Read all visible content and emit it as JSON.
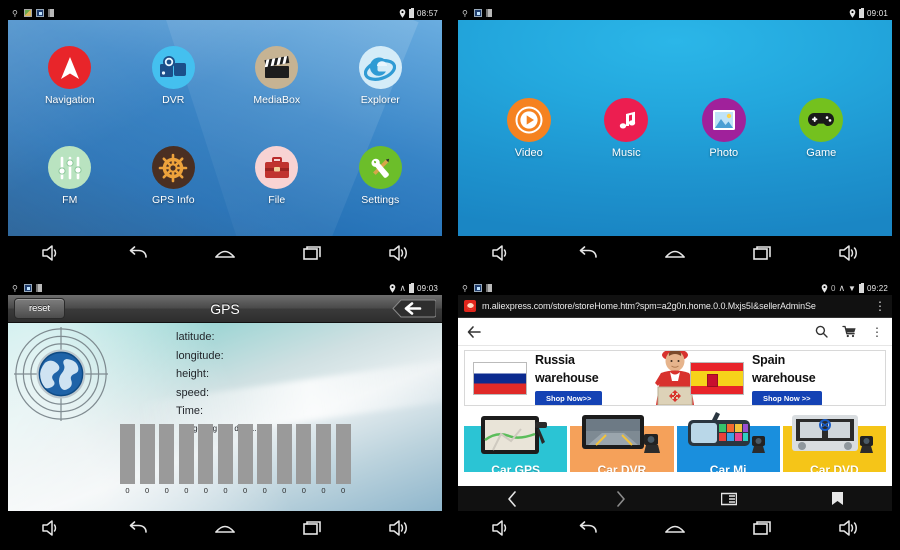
{
  "panels": {
    "launcher_main": {
      "status": {
        "time": "08:57",
        "icons": [
          "gps-icon",
          "gallery-icon",
          "screenshot-icon",
          "sdcard-icon",
          "location-pin-icon",
          "battery-icon"
        ]
      },
      "apps": [
        {
          "label": "Navigation",
          "icon": "navigation-arrow-icon",
          "color": "#e8252a"
        },
        {
          "label": "DVR",
          "icon": "dashcam-icon",
          "color": "#44c0ef"
        },
        {
          "label": "MediaBox",
          "icon": "clapperboard-icon",
          "color": "#c6b393"
        },
        {
          "label": "Explorer",
          "icon": "internet-explorer-icon",
          "color": "#cfeaf8"
        },
        {
          "label": "FM",
          "icon": "equalizer-sliders-icon",
          "color": "#b9e3c0"
        },
        {
          "label": "GPS Info",
          "icon": "ship-wheel-icon",
          "color": "#4a2f22"
        },
        {
          "label": "File",
          "icon": "briefcase-icon",
          "color": "#f8d3d3"
        },
        {
          "label": "Settings",
          "icon": "wrench-screwdriver-icon",
          "color": "#6cbe2a"
        }
      ],
      "navkeys": [
        "volume-down-icon",
        "back-icon",
        "home-icon",
        "recents-icon",
        "volume-up-icon"
      ]
    },
    "launcher_media": {
      "status": {
        "time": "09:01",
        "icons": [
          "gps-icon",
          "screenshot-icon",
          "sdcard-icon",
          "location-pin-icon",
          "battery-icon"
        ]
      },
      "apps": [
        {
          "label": "Video",
          "icon": "play-circle-icon",
          "color": "#f58220"
        },
        {
          "label": "Music",
          "icon": "music-note-icon",
          "color": "#ec1e50"
        },
        {
          "label": "Photo",
          "icon": "picture-icon",
          "color": "#a0219b"
        },
        {
          "label": "Game",
          "icon": "gamepad-icon",
          "color": "#74c11e"
        }
      ],
      "navkeys": [
        "volume-down-icon",
        "back-icon",
        "home-icon",
        "recents-icon",
        "volume-up-icon"
      ]
    },
    "gps": {
      "status": {
        "time": "09:03",
        "icons": [
          "gps-icon",
          "screenshot-icon",
          "sdcard-icon",
          "location-pin-icon",
          "headset-icon",
          "battery-icon"
        ]
      },
      "header": {
        "reset_label": "reset",
        "title": "GPS",
        "back_icon": "back-arrow-icon"
      },
      "fields": [
        "latitude:",
        "longitude:",
        "height:",
        "speed:",
        "Time:"
      ],
      "status_text": "getting gps data...",
      "satellite_values": [
        "0",
        "0",
        "0",
        "0",
        "0",
        "0",
        "0",
        "0",
        "0",
        "0",
        "0",
        "0"
      ],
      "navkeys": [
        "volume-down-icon",
        "back-icon",
        "home-icon",
        "recents-icon",
        "volume-up-icon"
      ]
    },
    "browser": {
      "status": {
        "time": "09:22",
        "icons": [
          "gps-icon",
          "screenshot-icon",
          "sdcard-icon",
          "location-pin-icon",
          "zero-icon",
          "headset-icon",
          "wifi-icon",
          "battery-icon"
        ]
      },
      "url": "m.aliexpress.com/store/storeHome.htm?spm=a2g0n.home.0.0.Mxjs5I&sellerAdminSe",
      "url_menu_icon": "kebab-menu-icon",
      "site_toolbar": {
        "back_icon": "back-arrow-icon",
        "search_icon": "search-icon",
        "cart_icon": "shopping-cart-icon",
        "menu_icon": "kebab-menu-icon"
      },
      "banner": {
        "left": {
          "flag": "russia-flag-icon",
          "title": "Russia\nwarehouse",
          "cta": "Shop Now>>"
        },
        "right": {
          "flag": "spain-flag-icon",
          "title": "Spain\nwarehouse",
          "cta": "Shop Now >>"
        },
        "courier": "courier-photo"
      },
      "products": [
        {
          "name": "Car GPS",
          "color": "#2bc4d4"
        },
        {
          "name": "Car DVR",
          "color": "#f5a15a"
        },
        {
          "name": "Car Mi",
          "color": "#1a8fdd"
        },
        {
          "name": "Car DVD",
          "color": "#f5c518"
        }
      ],
      "browser_nav": [
        "previous-page-icon",
        "next-page-icon",
        "tabs-icon",
        "bookmark-icon"
      ],
      "navkeys": [
        "volume-down-icon",
        "back-icon",
        "home-icon",
        "recents-icon",
        "volume-up-icon"
      ]
    }
  }
}
